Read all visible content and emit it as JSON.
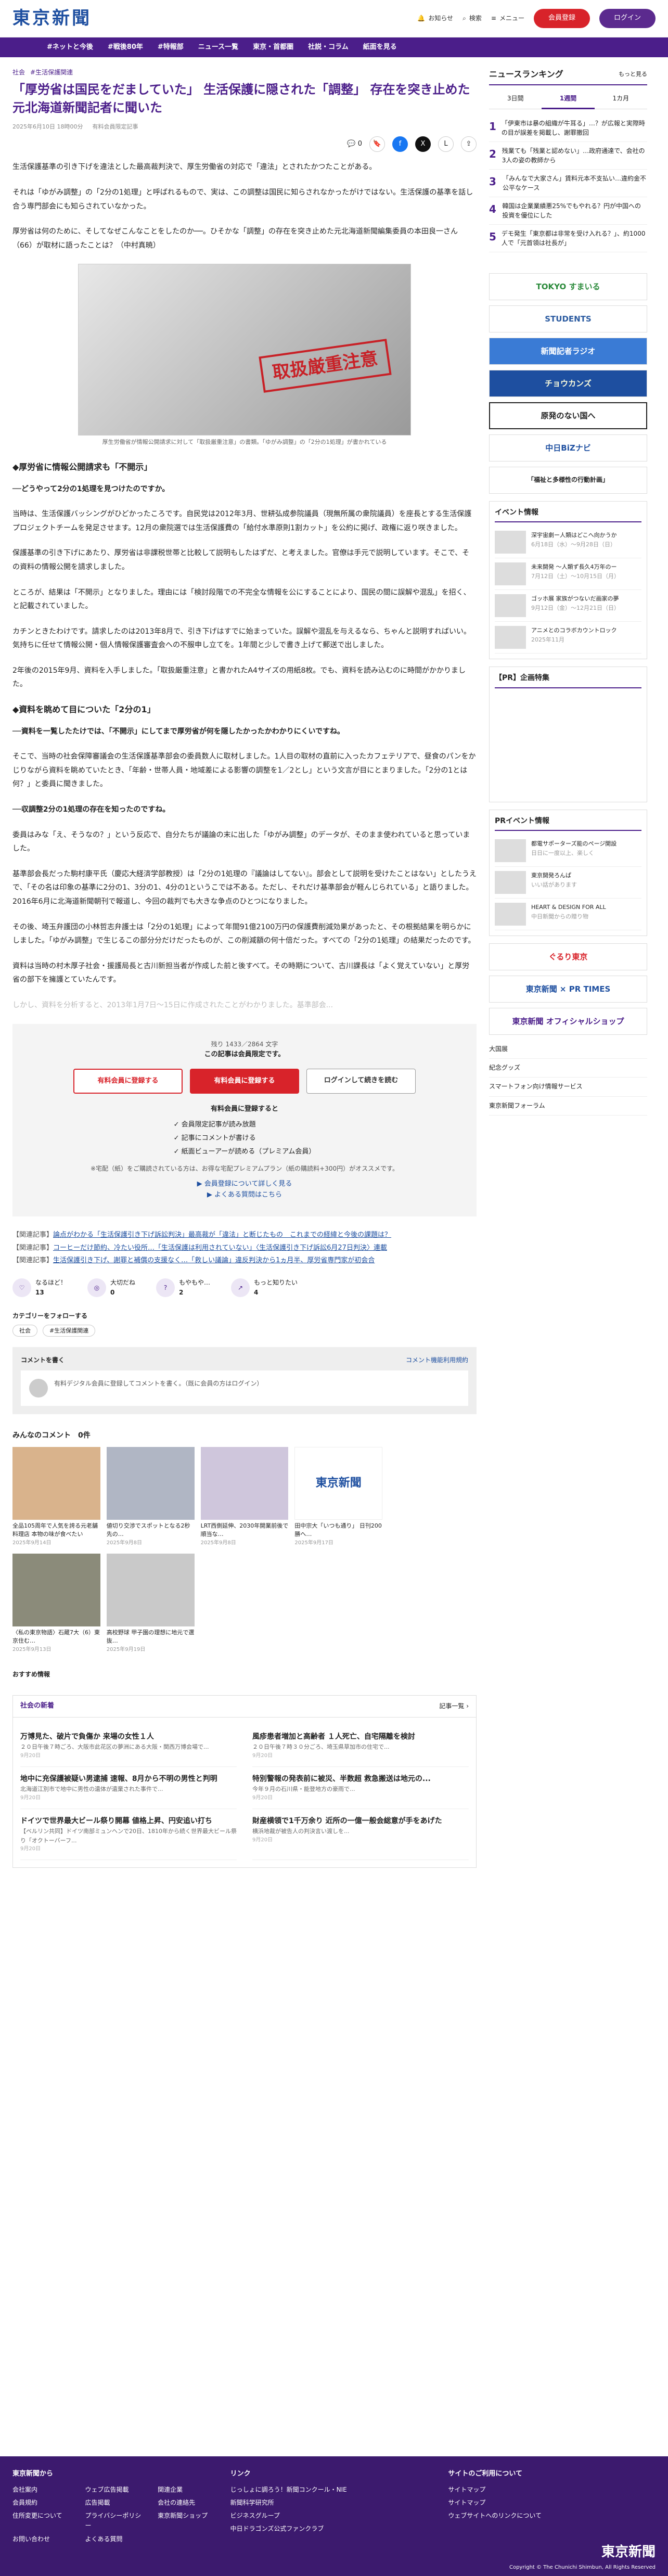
{
  "header": {
    "logo": "東京新聞",
    "notify": "お知らせ",
    "search": "検索",
    "menu": "メニュー",
    "register": "会員登録",
    "login": "ログイン"
  },
  "nav": [
    "#ネットと今後",
    "#戦後80年",
    "#特報部",
    "ニュース一覧",
    "東京・首都圏",
    "社説・コラム",
    "紙面を見る"
  ],
  "breadcrumb": [
    "社会",
    "#生活保護関連"
  ],
  "article": {
    "title": "「厚労省は国民をだましていた」 生活保護に隠された「調整」 存在を突き止めた元北海道新聞記者に聞いた",
    "date": "2025年6月10日 18時00分",
    "tag": "有料会員限定記事",
    "comments": "0",
    "p1": "生活保護基準の引き下げを違法とした最高裁判決で、厚生労働省の対応で「違法」とされたかつたことがある。",
    "p2": "それは「ゆがみ調整」の「2分の1処理」と呼ばれるもので、実は、この調整は国民に知らされなかったがけではない。生活保護の基準を話し合う専門部会にも知らされていなかった。",
    "p3": "厚労省は何のために、そしてなぜこんなことをしたのか──。ひそかな「調整」の存在を突き止めた元北海道新聞編集委員の本田良一さん（66）が取材に語ったことは？（中村真暁）",
    "caption": "厚生労働省が情報公開請求に対して「取扱厳重注意」の書類。「ゆがみ調整」の「2分の1処理」が書かれている",
    "stamp": "取扱厳重注意",
    "h2a": "◆厚労省に情報公開請求も「不開示」",
    "q1": "──どうやって2分の1処理を見つけたのですか。",
    "p4": "当時は、生活保護バッシングがひどかったころです。自民党は2012年3月、世耕弘成参院議員（現無所属の衆院議員）を座長とする生活保護プロジェクトチームを発足させます。12月の衆院選では生活保護費の「給付水準原則1割カット」を公約に掲げ、政権に返り咲きました。",
    "p5": "保護基準の引き下げにあたり、厚労省は非課税世帯と比較して説明もしたはずだ、と考えました。官僚は手元で説明しています。そこで、その資料の情報公開を請求しました。",
    "p6": "ところが、結果は「不開示」となりました。理由には「検討段階での不完全な情報を公にすることにより、国民の間に誤解や混乱」を招く、と記載されていました。",
    "p7": "カチンときたわけです。請求したのは2013年8月で、引き下げはすでに始まっていた。誤解や混乱を与えるなら、ちゃんと説明すればいい。気持ちに任せて情報公開・個人情報保護審査会への不服申し立てを。1年間と少しで書き上げて郵送で出しました。",
    "p8": "2年後の2015年9月、資料を入手しました。「取扱厳重注意」と書かれたA4サイズの用紙8枚。でも、資料を読み込むのに時間がかかりました。",
    "h2b": "◆資料を眺めて目についた「2分の1」",
    "q2": "──資料を一覧したたけでは、「不開示」にしてまで厚労省が何を隠したかったかわかりにくいですね。",
    "p9": "そこで、当時の社会保障審議会の生活保護基準部会の委員数人に取材しました。1人目の取材の直前に入ったカフェテリアで、昼食のパンをかじりながら資料を眺めていたとき、「年齢・世帯人員・地域差による影響の調整を1／2とし」という文言が目にとまりました。「2分の1とは何？」と委員に聞きました。",
    "q3": "──収調整2分の1処理の存在を知ったのですね。",
    "p10": "委員はみな「え、そうなの？」という反応で、自分たちが議論の末に出した「ゆがみ調整」のデータが、そのまま使われていると思っていました。",
    "p11": "基準部会長だった駒村康平氏（慶応大経済学部教授）は「2分の1処理の『議論はしてない』。部会として説明を受けたことはない」としたうえで、「その名は印象の基準に2分の1、3分の1、4分の1というこでは不ある。ただし、それだけ基準部会が軽んじられている」と語りました。2016年6月に北海道新聞朝刊で報道し、今回の裁判でも大きな争点のひとつになりました。",
    "p12": "その後、埼玉弁護団の小林哲志弁護士は「2分の1処理」によって年間91億2100万円の保護費削減効果があったと、その根拠結果を明らかにしました。「ゆがみ調整」で生じるこの部分分だけだったものが、この削減額の何十倍だった。すべての「2分の1処理」の結果だったのです。",
    "p13": "資料は当時の村木厚子社会・援護局長と古川新担当者が作成した前と後すべて。その時期について、古川課長は「よく覚えていない」と厚労省の部下を擁護とていたんです。",
    "p14": "しかし、資料を分析すると、2013年1月7日〜15日に作成されたことがわかりました。基準部会..."
  },
  "paywall": {
    "remaining": "残り 1433／2864 文字",
    "limited": "この記事は会員限定です。",
    "btn1": "有料会員に登録する",
    "btn2": "有料会員に登録する",
    "btn3": "ログインして続きを読む",
    "benefits_title": "有料会員に登録すると",
    "b1": "✓ 会員限定記事が読み放題",
    "b2": "✓ 記事にコメントが書ける",
    "b3": "✓ 紙面ビューアーが読める（プレミアム会員）",
    "note": "※宅配（紙）をご購読されている方は、お得な宅配プレミアムプラン（紙の購読料+300円）がオススメです。",
    "link1": "▶ 会員登録について詳しく見る",
    "link2": "▶ よくある質問はこちら"
  },
  "related": [
    {
      "tag": "【関連記事】",
      "text": "論点がわかる「生活保護引き下げ訴訟判決」最高裁が「違法」と断じたもの　これまでの経緯と今後の課題は？"
    },
    {
      "tag": "【関連記事】",
      "text": "コーヒーだけ節約、冷たい役所…「生活保護は利用されていない」〈生活保護引き下げ訴訟6月27日判決〉連載"
    },
    {
      "tag": "【関連記事】",
      "text": "生活保護引き下げ、謝罪と補償の支援なく…「救しい議論」違反判決から1ヵ月半、厚労省専門家が初会合"
    }
  ],
  "reactions": [
    {
      "icon": "♡",
      "label": "なるほど！",
      "count": "13"
    },
    {
      "icon": "◎",
      "label": "大切だね",
      "count": "0"
    },
    {
      "icon": "?",
      "label": "もやもや…",
      "count": "2"
    },
    {
      "icon": "↗",
      "label": "もっと知りたい",
      "count": "4"
    }
  ],
  "follow": {
    "title": "カテゴリーをフォローする",
    "chips": [
      "社会",
      "#生活保護関連"
    ]
  },
  "comment": {
    "head": "コメントを書く",
    "right": "コメント機能利用規約",
    "text": "有料デジタル会員に登録してコメントを書く。（既に会員の方はログイン）"
  },
  "everyone_comments": "みんなのコメント　0件",
  "cards": [
    {
      "title": "全品105周年で人気を誇る元老舗料理店 本物の味が食べたい",
      "date": "2025年9月14日"
    },
    {
      "title": "値切り交渉でスポットとなる2秒先の…",
      "date": "2025年9月8日"
    },
    {
      "title": "LRT西側延伸、2030年開業前後で順当な…",
      "date": "2025年9月8日"
    },
    {
      "title": "田中宗大「いつも通り」 日刊200勝へ…",
      "date": "2025年9月17日"
    },
    {
      "title": "〈私の東京物語〉石蔵7大（6）東京住む…",
      "date": "2025年9月13日"
    },
    {
      "title": "高校野球 甲子園の理想に地元で選抜…",
      "date": "2025年9月19日"
    }
  ],
  "recommend": "おすすめ情報",
  "news": {
    "head": "社会の新着",
    "more": "記事一覧 ›",
    "items": [
      {
        "title": "万博見た、破片で負傷か 来場の女性１人",
        "body": "２０日午後７時ごろ、大阪市此花区の夢洲にある大阪・関西万博会場で...",
        "date": "9月20日"
      },
      {
        "title": "風疹患者増加と高齢者 １人死亡、自宅隔離を検討",
        "body": "２０日午後７時３０分ごろ、埼玉県草加市の住宅で...",
        "date": "9月20日"
      },
      {
        "title": "地中に充保護被疑い男逮捕 速報、8月から不明の男性と判明",
        "body": "北海道江別市で地中に男性の遺体が遺棄された事件で...",
        "date": "9月20日"
      },
      {
        "title": "特別警報の発表前に被災、半数超 救急搬送は地元の...",
        "body": "今年９月の石川県・能登地方の豪雨で...",
        "date": "9月20日"
      },
      {
        "title": "ドイツで世界最大ビール祭り開幕 値格上昇、円安追い打ち",
        "body": "【ベルリン共同】ドイツ南部ミュンヘンで20日、1810年から続く世界最大ビール祭り「オクトーバーフ...",
        "date": "9月20日"
      },
      {
        "title": "財産横領で1千万余り 近所の一億一般会総意が手をあげた",
        "body": "横浜地裁が被告人の判決言い渡しを...",
        "date": "9月20日"
      }
    ]
  },
  "sidebar": {
    "ranking": "ニュースランキング",
    "more": "もっと見る",
    "tabs": [
      "3日間",
      "1週間",
      "1カ月"
    ],
    "items": [
      {
        "num": "1",
        "text": "「伊東市は暴の組織が牛耳る」…？が広報と実際時の目が誤差を掲載し、謝罪撤回"
      },
      {
        "num": "2",
        "text": "残業ても「残業と認めない」…政府通達で、会社の3人の姿の教師から"
      },
      {
        "num": "3",
        "text": "「みんなで大家さん」賃料元本不支払い…違約金不公平なケース"
      },
      {
        "num": "4",
        "text": "韓国は企業業績悪25%でもやれる？円が中国への投資を優位にした"
      },
      {
        "num": "5",
        "text": "デモ発生「東京都は非常を受け入れる？」、約1000人で「元首領は社長が」"
      }
    ],
    "banners": [
      "TOKYO すまいる",
      "STUDENTS",
      "新聞記者ラジオ",
      "チョウカンズ",
      "原発のない国へ",
      "中日BiZナビ",
      "「福祉と多様性の行動計画」"
    ],
    "events_title": "イベント情報",
    "events": [
      {
        "text": "深宇宙劇ー人類はどこへ向かうか",
        "date": "6月18日（水）〜9月28日（日）"
      },
      {
        "text": "未来開発 〜人類ず長久4万年のー",
        "date": "7月12日（土）〜10月15日（月）"
      },
      {
        "text": "ゴッホ展 家族がつないだ画家の夢",
        "date": "9月12日（金）〜12月21日（日）"
      },
      {
        "text": "アニメとのコラボカウントロック",
        "date": "2025年11月"
      }
    ],
    "pr": "【PR】企画特集",
    "pr_events": "PRイベント情報",
    "pr_items": [
      {
        "text": "都電サポーターズ能のページ開設",
        "date": "日日に一度以上、楽しく"
      },
      {
        "text": "東京開発ろんぱ",
        "date": "いい話があります"
      },
      {
        "text": "HEART & DESIGN FOR ALL",
        "date": "中日新聞からの贈り物"
      }
    ],
    "banners2": [
      "ぐるり東京",
      "東京新聞 × PR TIMES",
      "東京新聞 オフィシャルショップ"
    ],
    "links": [
      "大国展",
      "紀念グッズ",
      "スマートフォン向け情報サービス",
      "東京新聞フォーラム"
    ]
  },
  "footer": {
    "col1_title": "東京新聞から",
    "col1": [
      "会社案内",
      "ウェブ広告掲載",
      "関連企業",
      "会員規約",
      "広告掲載",
      "会社の連絡先",
      "住所変更について",
      "プライバシーポリシー",
      "東京新聞ショップ",
      "お問い合わせ",
      "よくある質問"
    ],
    "col2_title": "リンク",
    "col2": [
      "じっしょに調ろう！新聞コンクール・NIE",
      "新聞科学研究所",
      "ビジネスグループ",
      "中日ドラゴンズ公式ファンクラブ"
    ],
    "col3_title": "サイトのご利用について",
    "col3": [
      "サイトマップ",
      "サイトマップ",
      "ウェブサイトへのリンクについて"
    ],
    "logo": "東京新聞",
    "copyright": "Copyright © The Chunichi Shimbun, All Rights Reserved"
  },
  "colors": {
    "brand": "#4b1e8a",
    "accent": "#d8232a",
    "link": "#1e4fa0"
  }
}
